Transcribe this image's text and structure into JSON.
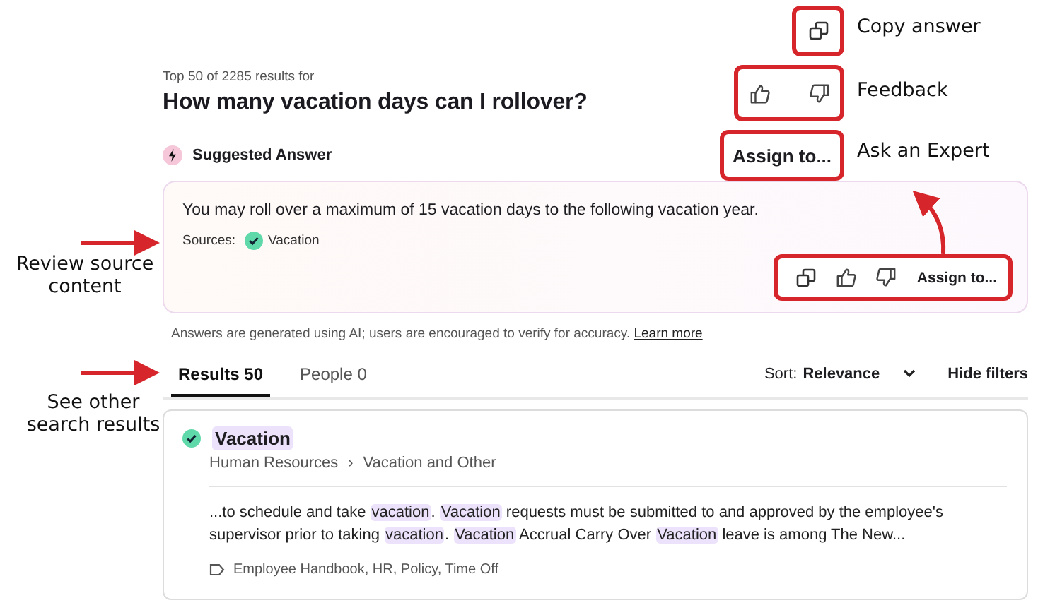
{
  "header": {
    "meta": "Top 50 of 2285 results for",
    "query": "How many vacation days can I rollover?"
  },
  "suggested_answer": {
    "label": "Suggested Answer",
    "assign_button": "Assign to...",
    "text": "You may roll over a maximum of 15 vacation days to the following vacation year.",
    "sources_label": "Sources:",
    "sources": [
      {
        "title": "Vacation",
        "verified": true
      }
    ],
    "action_assign": "Assign to..."
  },
  "disclaimer": {
    "text": "Answers are generated using AI; users are encouraged to verify for accuracy.",
    "link": "Learn more"
  },
  "tabs": [
    {
      "label": "Results 50",
      "selected": true
    },
    {
      "label": "People 0",
      "selected": false
    }
  ],
  "sort": {
    "label": "Sort:",
    "value": "Relevance"
  },
  "hide_filters": "Hide filters",
  "results": [
    {
      "title": "Vacation",
      "verified": true,
      "breadcrumb": [
        "Human Resources",
        "Vacation and Other"
      ],
      "breadcrumb_separator": "›",
      "snippet": [
        {
          "text": "...to schedule and take ",
          "highlight": false
        },
        {
          "text": "vacation",
          "highlight": true
        },
        {
          "text": ". ",
          "highlight": false
        },
        {
          "text": "Vacation",
          "highlight": true
        },
        {
          "text": " requests must be submitted to and approved by the employee's supervisor prior to taking ",
          "highlight": false
        },
        {
          "text": "vacation",
          "highlight": true
        },
        {
          "text": ". ",
          "highlight": false
        },
        {
          "text": "Vacation",
          "highlight": true
        },
        {
          "text": " Accrual Carry Over ",
          "highlight": false
        },
        {
          "text": "Vacation",
          "highlight": true
        },
        {
          "text": " leave is among The New...",
          "highlight": false
        }
      ],
      "tags": "Employee Handbook, HR, Policy, Time Off"
    }
  ],
  "annotations": [
    {
      "kind": "right",
      "text": "Copy answer"
    },
    {
      "kind": "right",
      "text": "Feedback"
    },
    {
      "kind": "right",
      "text": "Ask an Expert"
    },
    {
      "kind": "left",
      "text": "Review source content"
    },
    {
      "kind": "left",
      "text": "See other search results"
    }
  ]
}
